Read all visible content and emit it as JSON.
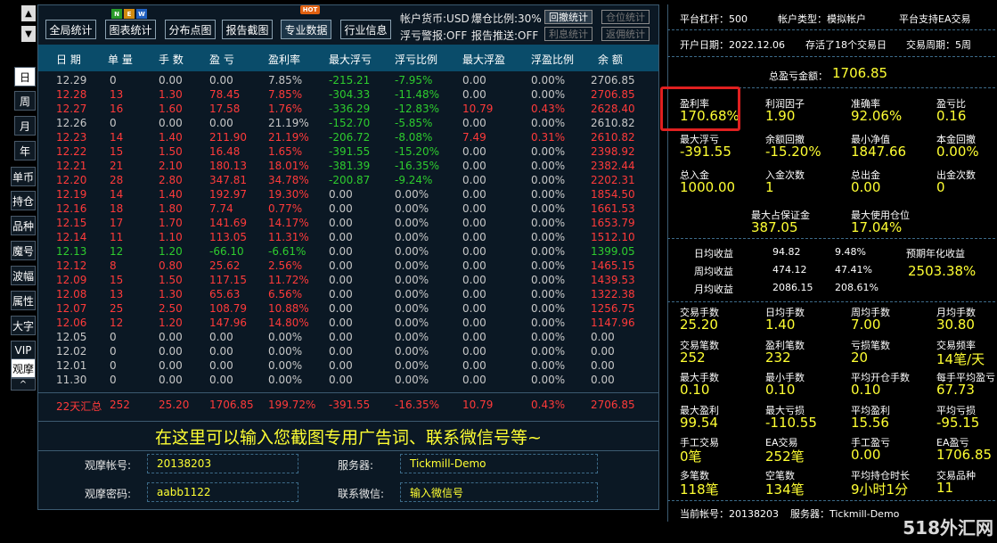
{
  "left_tabs": {
    "up_arrow": "▲",
    "down_arrow": "▼",
    "day": "日",
    "week": "周",
    "month": "月",
    "year": "年",
    "single": "单币",
    "hold": "持仓",
    "variety": "品种",
    "magic": "魔号",
    "amplitude": "波幅",
    "attr": "属性",
    "bigfont": "大字",
    "vip": "VIP",
    "watch": "观摩",
    "caret": "^"
  },
  "toolbar": {
    "global_stats": "全局统计",
    "chart_stats": "图表统计",
    "distribution": "分布点图",
    "report_screenshot": "报告截图",
    "pro_data": "专业数据",
    "industry_info": "行业信息",
    "new_badge": [
      "N",
      "E",
      "W"
    ],
    "hot_badge": "HOT"
  },
  "account_info": {
    "currency": "帐户货币:USD",
    "margin_ratio": "爆仓比例:30%",
    "float_warning": "浮亏警报:OFF",
    "report_push": "报告推送:OFF",
    "drawdown_stats": "回撤统计",
    "position_stats": "仓位统计",
    "interest_stats": "利息统计",
    "rebate_stats": "返佣统计"
  },
  "table": {
    "headers": [
      "日 期",
      "单 量",
      "手 数",
      "盈 亏",
      "盈利率",
      "最大浮亏",
      "浮亏比例",
      "最大浮盈",
      "浮盈比例",
      "余 额"
    ],
    "rows": [
      {
        "tone": "gray",
        "c": [
          "12.29",
          "0",
          "0.00",
          "0.00",
          "7.85%",
          "-215.21",
          "-7.95%",
          "0.00",
          "0.00%",
          "2706.85"
        ]
      },
      {
        "tone": "red",
        "c": [
          "12.28",
          "13",
          "1.30",
          "78.45",
          "7.85%",
          "-304.33",
          "-11.48%",
          "0.00",
          "0.00%",
          "2706.85"
        ]
      },
      {
        "tone": "red",
        "c": [
          "12.27",
          "16",
          "1.60",
          "17.58",
          "1.76%",
          "-336.29",
          "-12.83%",
          "10.79",
          "0.43%",
          "2628.40"
        ]
      },
      {
        "tone": "gray",
        "c": [
          "12.26",
          "0",
          "0.00",
          "0.00",
          "21.19%",
          "-152.70",
          "-5.85%",
          "0.00",
          "0.00%",
          "2610.82"
        ]
      },
      {
        "tone": "red",
        "c": [
          "12.23",
          "14",
          "1.40",
          "211.90",
          "21.19%",
          "-206.72",
          "-8.08%",
          "7.49",
          "0.31%",
          "2610.82"
        ]
      },
      {
        "tone": "red",
        "c": [
          "12.22",
          "15",
          "1.50",
          "16.48",
          "1.65%",
          "-391.55",
          "-15.20%",
          "0.00",
          "0.00%",
          "2398.92"
        ]
      },
      {
        "tone": "red",
        "c": [
          "12.21",
          "21",
          "2.10",
          "180.13",
          "18.01%",
          "-381.39",
          "-16.35%",
          "0.00",
          "0.00%",
          "2382.44"
        ]
      },
      {
        "tone": "red",
        "c": [
          "12.20",
          "28",
          "2.80",
          "347.81",
          "34.78%",
          "-200.87",
          "-9.24%",
          "0.00",
          "0.00%",
          "2202.31"
        ]
      },
      {
        "tone": "red",
        "c": [
          "12.19",
          "14",
          "1.40",
          "192.97",
          "19.30%",
          "0.00",
          "0.00%",
          "0.00",
          "0.00%",
          "1854.50"
        ]
      },
      {
        "tone": "red",
        "c": [
          "12.16",
          "18",
          "1.80",
          "7.74",
          "0.77%",
          "0.00",
          "0.00%",
          "0.00",
          "0.00%",
          "1661.53"
        ]
      },
      {
        "tone": "red",
        "c": [
          "12.15",
          "17",
          "1.70",
          "141.69",
          "14.17%",
          "0.00",
          "0.00%",
          "0.00",
          "0.00%",
          "1653.79"
        ]
      },
      {
        "tone": "red",
        "c": [
          "12.14",
          "11",
          "1.10",
          "113.05",
          "11.31%",
          "0.00",
          "0.00%",
          "0.00",
          "0.00%",
          "1512.10"
        ]
      },
      {
        "tone": "green",
        "c": [
          "12.13",
          "12",
          "1.20",
          "-66.10",
          "-6.61%",
          "0.00",
          "0.00%",
          "0.00",
          "0.00%",
          "1399.05"
        ]
      },
      {
        "tone": "red",
        "c": [
          "12.12",
          "8",
          "0.80",
          "25.62",
          "2.56%",
          "0.00",
          "0.00%",
          "0.00",
          "0.00%",
          "1465.15"
        ]
      },
      {
        "tone": "red",
        "c": [
          "12.09",
          "15",
          "1.50",
          "117.15",
          "11.72%",
          "0.00",
          "0.00%",
          "0.00",
          "0.00%",
          "1439.53"
        ]
      },
      {
        "tone": "red",
        "c": [
          "12.08",
          "13",
          "1.30",
          "65.63",
          "6.56%",
          "0.00",
          "0.00%",
          "0.00",
          "0.00%",
          "1322.38"
        ]
      },
      {
        "tone": "red",
        "c": [
          "12.07",
          "25",
          "2.50",
          "108.79",
          "10.88%",
          "0.00",
          "0.00%",
          "0.00",
          "0.00%",
          "1256.75"
        ]
      },
      {
        "tone": "red",
        "c": [
          "12.06",
          "12",
          "1.20",
          "147.96",
          "14.80%",
          "0.00",
          "0.00%",
          "0.00",
          "0.00%",
          "1147.96"
        ]
      },
      {
        "tone": "gray",
        "c": [
          "12.05",
          "0",
          "0.00",
          "0.00",
          "0.00%",
          "0.00",
          "0.00%",
          "0.00",
          "0.00%",
          "0.00"
        ]
      },
      {
        "tone": "gray",
        "c": [
          "12.02",
          "0",
          "0.00",
          "0.00",
          "0.00%",
          "0.00",
          "0.00%",
          "0.00",
          "0.00%",
          "0.00"
        ]
      },
      {
        "tone": "gray",
        "c": [
          "12.01",
          "0",
          "0.00",
          "0.00",
          "0.00%",
          "0.00",
          "0.00%",
          "0.00",
          "0.00%",
          "0.00"
        ]
      },
      {
        "tone": "gray",
        "c": [
          "11.30",
          "0",
          "0.00",
          "0.00",
          "0.00%",
          "0.00",
          "0.00%",
          "0.00",
          "0.00%",
          "0.00"
        ]
      }
    ],
    "summary": [
      "22天汇总",
      "252",
      "25.20",
      "1706.85",
      "199.72%",
      "-391.55",
      "-16.35%",
      "10.79",
      "0.43%",
      "2706.85"
    ]
  },
  "ad_text": "在这里可以输入您截图专用广告词、联系微信号等~",
  "footer_form": {
    "watch_account_label": "观摩帐号:",
    "watch_account_value": "20138203",
    "server_label": "服务器:",
    "server_value": "Tickmill-Demo",
    "watch_password_label": "观摩密码:",
    "watch_password_value": "aabb1122",
    "wechat_label": "联系微信:",
    "wechat_value": "输入微信号"
  },
  "right_panel": {
    "leverage": "平台杠杆：500",
    "account_type": "帐户类型：模拟帐户",
    "ea_support": "平台支持EA交易",
    "open_date": "开户日期：2022.12.06",
    "survived": "存活了18个交易日",
    "trade_period": "交易周期：5周",
    "total_pnl_label": "总盈亏金额：",
    "total_pnl_value": "1706.85",
    "metrics_a": [
      {
        "label": "盈利率",
        "value": "170.68%"
      },
      {
        "label": "利润因子",
        "value": "1.90"
      },
      {
        "label": "准确率",
        "value": "92.06%"
      },
      {
        "label": "盈亏比",
        "value": "0.16"
      },
      {
        "label": "最大浮亏",
        "value": "-391.55"
      },
      {
        "label": "余额回撤",
        "value": "-15.20%"
      },
      {
        "label": "最小净值",
        "value": "1847.66"
      },
      {
        "label": "本金回撤",
        "value": "0.00%"
      },
      {
        "label": "总入金",
        "value": "1000.00"
      },
      {
        "label": "入金次数",
        "value": "1"
      },
      {
        "label": "总出金",
        "value": "0.00"
      },
      {
        "label": "出金次数",
        "value": "0"
      }
    ],
    "max_margin_label": "最大占保证金",
    "max_margin_value": "387.05",
    "max_position_label": "最大使用仓位",
    "max_position_value": "17.04%",
    "daily_label": "日均收益",
    "daily_value": "94.82",
    "daily_pct": "9.48%",
    "weekly_label": "周均收益",
    "weekly_value": "474.12",
    "weekly_pct": "47.41%",
    "monthly_label": "月均收益",
    "monthly_value": "2086.15",
    "monthly_pct": "208.61%",
    "annual_label": "预期年化收益",
    "annual_value": "2503.38%",
    "metrics_b": [
      {
        "label": "交易手数",
        "value": "25.20"
      },
      {
        "label": "日均手数",
        "value": "1.40"
      },
      {
        "label": "周均手数",
        "value": "7.00"
      },
      {
        "label": "月均手数",
        "value": "30.80"
      },
      {
        "label": "交易笔数",
        "value": "252"
      },
      {
        "label": "盈利笔数",
        "value": "232"
      },
      {
        "label": "亏损笔数",
        "value": "20"
      },
      {
        "label": "交易频率",
        "value": "14笔/天"
      },
      {
        "label": "最大手数",
        "value": "0.10"
      },
      {
        "label": "最小手数",
        "value": "0.10"
      },
      {
        "label": "平均开仓手数",
        "value": "0.10"
      },
      {
        "label": "每手平均盈亏",
        "value": "67.73"
      },
      {
        "label": "最大盈利",
        "value": "99.54"
      },
      {
        "label": "最大亏损",
        "value": "-110.55"
      },
      {
        "label": "平均盈利",
        "value": "15.56"
      },
      {
        "label": "平均亏损",
        "value": "-95.15"
      },
      {
        "label": "手工交易",
        "value": "0笔"
      },
      {
        "label": "EA交易",
        "value": "252笔"
      },
      {
        "label": "手工盈亏",
        "value": "0.00"
      },
      {
        "label": "EA盈亏",
        "value": "1706.85"
      },
      {
        "label": "多笔数",
        "value": "118笔"
      },
      {
        "label": "空笔数",
        "value": "134笔"
      },
      {
        "label": "平均持仓时长",
        "value": "9小时1分"
      },
      {
        "label": "交易品种",
        "value": "11"
      }
    ],
    "current_account": "当前帐号：20138203",
    "server": "服务器：Tickmill-Demo"
  },
  "watermark": "518外汇网",
  "colors": {
    "highlight_box": "#e02020",
    "value_yellow": "#ffff33",
    "header_bg": "#0a4c6a"
  }
}
